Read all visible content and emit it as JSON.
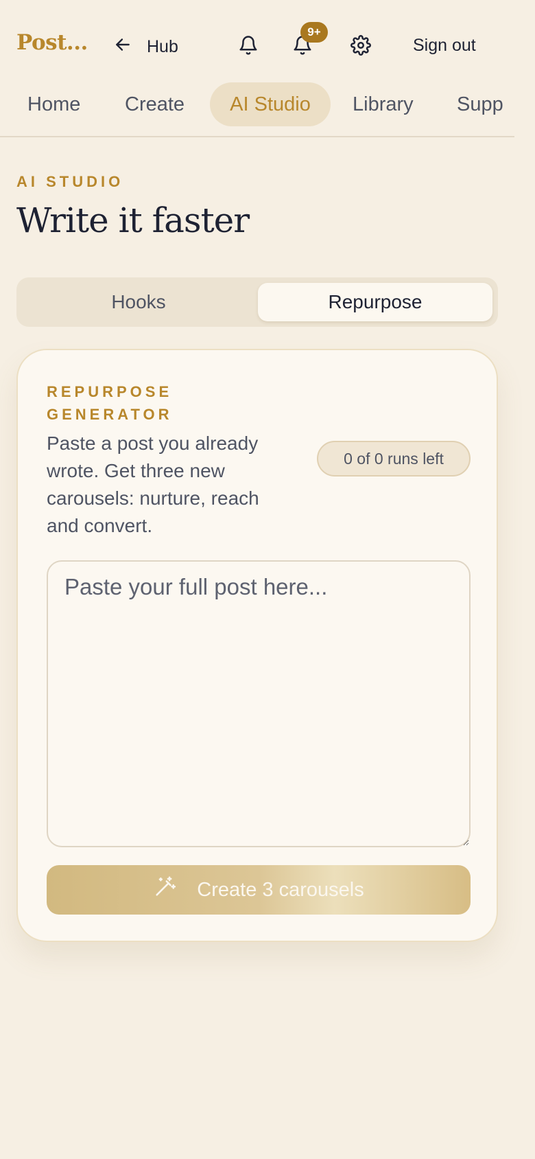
{
  "header": {
    "brand": "Post...",
    "back_label": "Hub",
    "notification_badge": "9+",
    "signout_label": "Sign out"
  },
  "nav": {
    "tabs": [
      {
        "label": "Home"
      },
      {
        "label": "Create"
      },
      {
        "label": "AI Studio",
        "active": true
      },
      {
        "label": "Library"
      },
      {
        "label": "Supp"
      }
    ]
  },
  "page": {
    "eyebrow": "AI STUDIO",
    "title": "Write it faster"
  },
  "segmented": {
    "options": [
      "Hooks",
      "Repurpose"
    ],
    "selected": "Repurpose"
  },
  "card": {
    "eyebrow": "REPURPOSE GENERATOR",
    "description": "Paste a post you already wrote. Get three new carousels: nurture, reach and convert.",
    "runs_left": "0 of 0 runs left",
    "input_placeholder": "Paste your full post here...",
    "input_value": "",
    "button_label": "Create 3 carousels"
  },
  "colors": {
    "accent": "#b8872c",
    "badge": "#a9781f",
    "background": "#f6efe3",
    "card": "#fcf8f1"
  },
  "icons": [
    "arrow-left-icon",
    "bell-icon",
    "bell-icon",
    "gear-icon",
    "magic-wand-icon"
  ]
}
